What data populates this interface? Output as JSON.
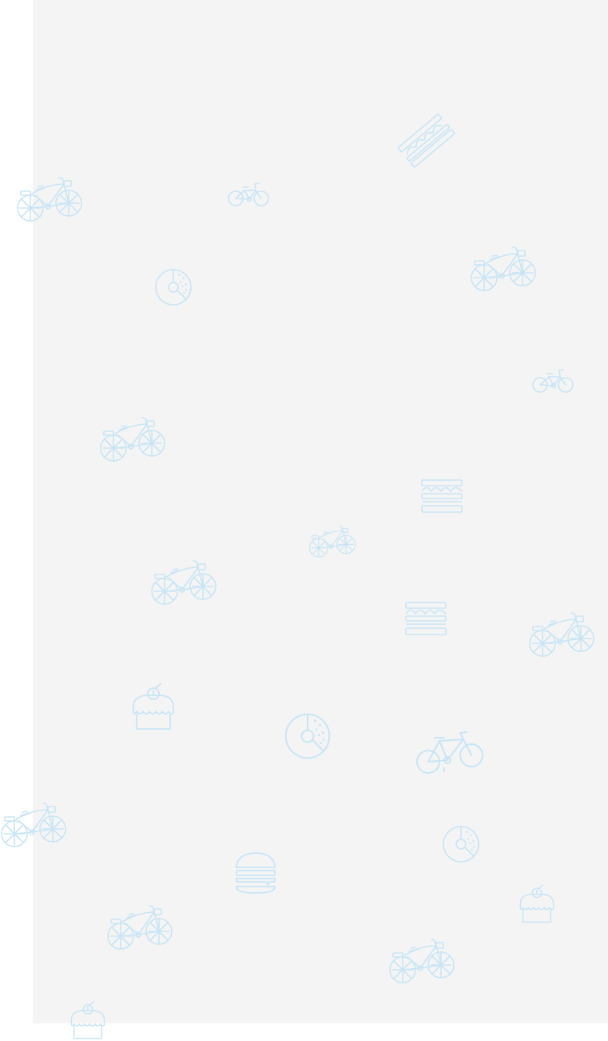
{
  "colors": {
    "background": "#ffffff",
    "panel": "#f4f4f4",
    "icon_stroke": "#c9e5f5"
  },
  "pattern": {
    "icons": [
      "sandwich-slice-icon",
      "cruiser-bicycle-icon",
      "small-bicycle-icon",
      "cruiser-bicycle-icon",
      "donut-icon",
      "small-bicycle-icon",
      "cruiser-bicycle-icon",
      "sandwich-icon",
      "cruiser-bicycle-icon",
      "cruiser-bicycle-icon",
      "sandwich-icon",
      "cruiser-bicycle-icon",
      "cake-icon",
      "donut-icon",
      "bicycle-icon",
      "cruiser-bicycle-icon",
      "donut-icon",
      "burger-icon",
      "cake-icon",
      "cruiser-bicycle-icon",
      "cruiser-bicycle-icon",
      "cake-icon"
    ]
  }
}
